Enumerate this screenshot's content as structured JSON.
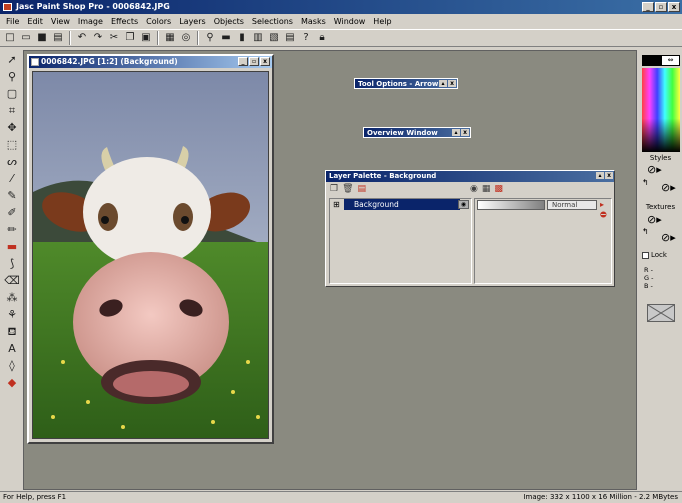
{
  "window": {
    "title": "Jasc Paint Shop Pro - 0006842.JPG",
    "btn_min": "_",
    "btn_max": "▫",
    "btn_close": "x"
  },
  "menu": [
    "File",
    "Edit",
    "View",
    "Image",
    "Effects",
    "Colors",
    "Layers",
    "Objects",
    "Selections",
    "Masks",
    "Window",
    "Help"
  ],
  "image_window": {
    "title": "0006842.JPG [1:2] (Background)"
  },
  "tool_options": {
    "title": "Tool Options - Arrow"
  },
  "overview": {
    "title": "Overview Window"
  },
  "layer_palette": {
    "title": "Layer Palette - Background",
    "layer_name": "Background",
    "blend_mode": "Normal"
  },
  "color_panel": {
    "styles_label": "Styles",
    "textures_label": "Textures",
    "lock_label": "Lock",
    "rgb": [
      "R  -",
      "G  -",
      "B  -"
    ]
  },
  "status": {
    "left": "For Help, press F1",
    "right": "Image: 332 x 1100 x 16 Million - 2.2 MBytes"
  },
  "colors": {
    "titlebar": "#0a246a",
    "workspace": "#8a8a80",
    "chrome": "#d4d0c8"
  }
}
